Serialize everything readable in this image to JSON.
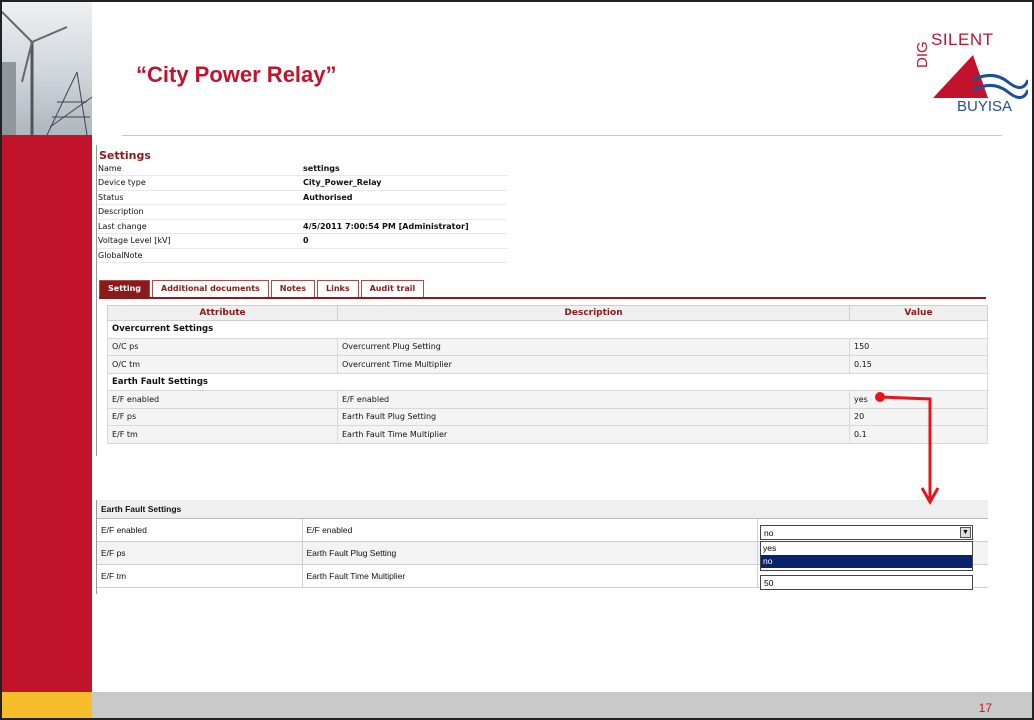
{
  "slide": {
    "title": "“City Power Relay”",
    "page_number": "17",
    "colors": {
      "brand_red": "#c1132c",
      "accent_yellow": "#f6bd2c",
      "dark_red": "#8b1a1a",
      "selection_blue": "#0a246a"
    }
  },
  "logo": {
    "line1": "SILENT",
    "line2": "DIG",
    "line3": "BUYISA"
  },
  "settings": {
    "heading": "Settings",
    "properties": [
      {
        "key": "Name",
        "value": "settings"
      },
      {
        "key": "Device type",
        "value": "City_Power_Relay"
      },
      {
        "key": "Status",
        "value": "Authorised"
      },
      {
        "key": "Description",
        "value": ""
      },
      {
        "key": "Last change",
        "value": "4/5/2011 7:00:54 PM [Administrator]"
      },
      {
        "key": "Voltage Level [kV]",
        "value": "0"
      },
      {
        "key": "GlobalNote",
        "value": ""
      }
    ],
    "tabs": [
      "Setting",
      "Additional documents",
      "Notes",
      "Links",
      "Audit trail"
    ],
    "active_tab": "Setting",
    "table": {
      "headers": [
        "Attribute",
        "Description",
        "Value"
      ],
      "groups": [
        {
          "title": "Overcurrent Settings",
          "rows": [
            {
              "attribute": "O/C ps",
              "description": "Overcurrent Plug Setting",
              "value": "150"
            },
            {
              "attribute": "O/C tm",
              "description": "Overcurrent Time Multiplier",
              "value": "0.15"
            }
          ]
        },
        {
          "title": "Earth Fault Settings",
          "rows": [
            {
              "attribute": "E/F enabled",
              "description": "E/F enabled",
              "value": "yes"
            },
            {
              "attribute": "E/F ps",
              "description": "Earth Fault Plug Setting",
              "value": "20"
            },
            {
              "attribute": "E/F tm",
              "description": "Earth Fault Time Multiplier",
              "value": "0.1"
            }
          ]
        }
      ]
    }
  },
  "edit": {
    "group_title": "Earth Fault Settings",
    "rows": [
      {
        "attribute": "E/F enabled",
        "description": "E/F enabled"
      },
      {
        "attribute": "E/F ps",
        "description": "Earth Fault Plug Setting"
      },
      {
        "attribute": "E/F tm",
        "description": "Earth Fault Time Multiplier"
      }
    ],
    "ef_enabled_selected": "no",
    "ef_enabled_options": [
      "yes",
      "no"
    ],
    "ef_tm_value": "50"
  },
  "icons": {
    "select_arrow": "chevron-down-icon"
  }
}
